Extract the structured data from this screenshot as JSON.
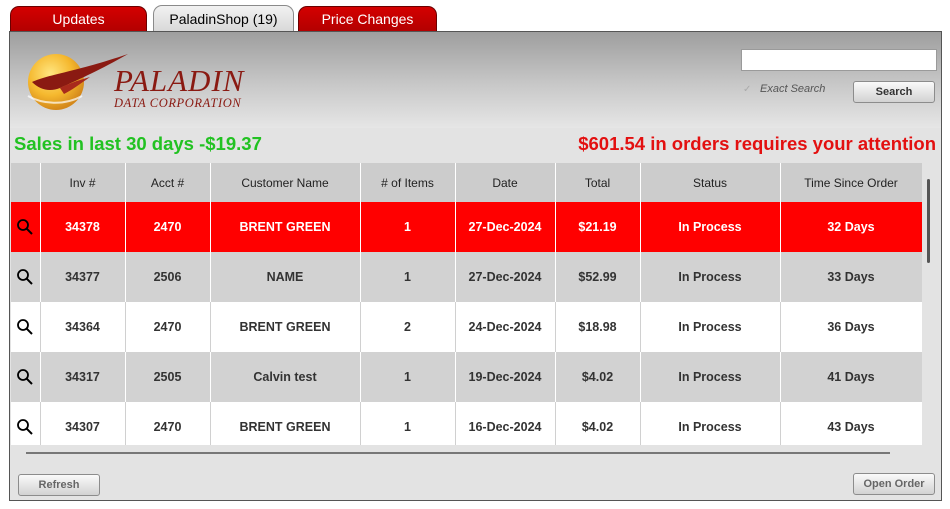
{
  "tabs": [
    {
      "label": "Updates",
      "state": "inactive"
    },
    {
      "label": "PaladinShop (19)",
      "state": "active"
    },
    {
      "label": "Price Changes",
      "state": "inactive"
    }
  ],
  "logo": {
    "name": "PALADIN",
    "subtitle": "DATA CORPORATION"
  },
  "search": {
    "value": "",
    "exact_label": "Exact Search",
    "button_label": "Search"
  },
  "summary": {
    "sales": "Sales in last 30 days  -$19.37",
    "attention": "$601.54 in orders requires your attention"
  },
  "table": {
    "columns": [
      "",
      "Inv #",
      "Acct #",
      "Customer Name",
      "# of Items",
      "Date",
      "Total",
      "Status",
      "Time Since Order"
    ],
    "rows": [
      {
        "inv": "34378",
        "acct": "2470",
        "customer": "BRENT GREEN",
        "items": "1",
        "date": "27-Dec-2024",
        "total": "$21.19",
        "status": "In Process",
        "time": "32 Days",
        "selected": true
      },
      {
        "inv": "34377",
        "acct": "2506",
        "customer": "NAME",
        "items": "1",
        "date": "27-Dec-2024",
        "total": "$52.99",
        "status": "In Process",
        "time": "33 Days",
        "selected": false
      },
      {
        "inv": "34364",
        "acct": "2470",
        "customer": "BRENT GREEN",
        "items": "2",
        "date": "24-Dec-2024",
        "total": "$18.98",
        "status": "In Process",
        "time": "36 Days",
        "selected": false
      },
      {
        "inv": "34317",
        "acct": "2505",
        "customer": "Calvin test",
        "items": "1",
        "date": "19-Dec-2024",
        "total": "$4.02",
        "status": "In Process",
        "time": "41 Days",
        "selected": false
      },
      {
        "inv": "34307",
        "acct": "2470",
        "customer": "BRENT GREEN",
        "items": "1",
        "date": "16-Dec-2024",
        "total": "$4.02",
        "status": "In Process",
        "time": "43 Days",
        "selected": false
      }
    ]
  },
  "footer": {
    "refresh_label": "Refresh",
    "open_order_label": "Open Order"
  },
  "colors": {
    "tab_red": "#c80000",
    "selected_row": "#ff0000",
    "sales_green": "#22c222",
    "attention_red": "#e31010",
    "brand": "#8a1a12"
  }
}
